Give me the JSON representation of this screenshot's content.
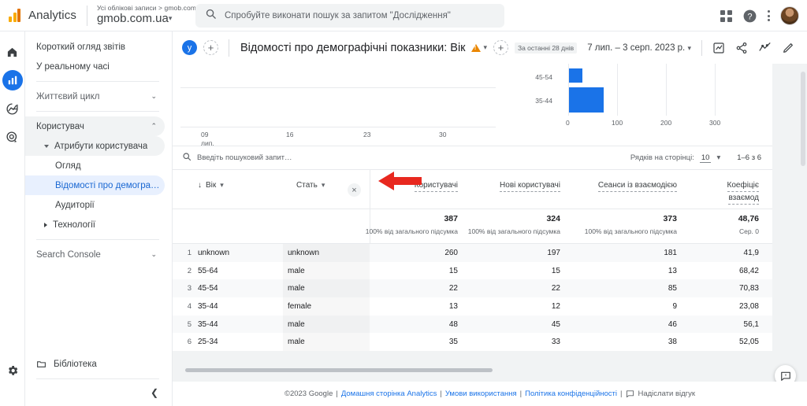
{
  "topbar": {
    "product": "Analytics",
    "account_breadcrumb": "Усі облікові записи > gmob.com.ua",
    "property_name": "gmob.com.ua",
    "property_caret": "▾",
    "search_placeholder": "Спробуйте виконати пошук за запитом \"Дослідження\"",
    "icons": {
      "search": "search-icon",
      "apps": "apps-grid-icon",
      "help": "help-icon",
      "more": "more-vert-icon",
      "avatar": "user-avatar"
    }
  },
  "rail": {
    "items": [
      {
        "name": "home",
        "label": "Головна",
        "active": false
      },
      {
        "name": "reports",
        "label": "Звіти",
        "active": true
      },
      {
        "name": "explore",
        "label": "Дослідження",
        "active": false
      },
      {
        "name": "advertising",
        "label": "Реклама",
        "active": false
      }
    ],
    "settings_label": "Адміністратор"
  },
  "sidebar": {
    "items": [
      {
        "label": "Короткий огляд звітів",
        "indent": 0,
        "state": "normal",
        "toggle": ""
      },
      {
        "label": "У реальному часі",
        "indent": 0,
        "state": "normal",
        "toggle": ""
      },
      {
        "label": "Життєвий цикл",
        "indent": 0,
        "state": "muted",
        "toggle": "chevron-down"
      },
      {
        "label": "Користувач",
        "indent": 0,
        "state": "sel-grey",
        "toggle": "chevron-up"
      },
      {
        "label": "Атрибути користувача",
        "indent": 1,
        "state": "sel-grey",
        "toggle": "tri-down"
      },
      {
        "label": "Огляд",
        "indent": 2,
        "state": "normal",
        "toggle": ""
      },
      {
        "label": "Відомості про демографічн…",
        "indent": 2,
        "state": "sel-blue",
        "toggle": ""
      },
      {
        "label": "Аудиторії",
        "indent": 2,
        "state": "normal",
        "toggle": ""
      },
      {
        "label": "Технології",
        "indent": 1,
        "state": "normal",
        "toggle": "tri-right"
      },
      {
        "label": "Search Console",
        "indent": 0,
        "state": "muted",
        "toggle": "chevron-down"
      }
    ],
    "library_label": "Бібліотека",
    "library_icon": "folder-icon",
    "collapse_icon": "chevron-left-icon"
  },
  "pagehead": {
    "badge_letter": "у",
    "add_badge": "+",
    "title": "Відомості про демографічні показники: Вік",
    "warning_icon": "warning-triangle-icon",
    "warning_caret": "▾",
    "add_comparison": "+",
    "date_chip": "За останні 28 днів",
    "date_range": "7 лип. – 3 серп. 2023 р.",
    "date_caret": "▾",
    "actions": [
      {
        "name": "insights-icon",
        "label": "Статистика"
      },
      {
        "name": "share-icon",
        "label": "Поділитися"
      },
      {
        "name": "compare-icon",
        "label": "Порівняти"
      },
      {
        "name": "edit-pencil-icon",
        "label": "Редагувати"
      }
    ]
  },
  "chart_data": [
    {
      "type": "line",
      "title": "",
      "xlabel": "",
      "ylabel": "",
      "x_ticks": [
        "09\nлип.",
        "16",
        "23",
        "30"
      ],
      "grid": true,
      "series": [
        {
          "name": "Користувачі",
          "values": []
        }
      ]
    },
    {
      "type": "bar",
      "orientation": "horizontal",
      "title": "",
      "categories": [
        "45-54",
        "35-44"
      ],
      "values": [
        22,
        61
      ],
      "xlim": [
        0,
        340
      ],
      "x_ticks": [
        0,
        100,
        200,
        300
      ],
      "xlabel": "",
      "ylabel": "",
      "color": "#1a73e8",
      "grid": true,
      "note": "Верхня частина діаграми обрізана"
    }
  ],
  "table": {
    "search_placeholder": "Введіть пошуковий запит…",
    "search_icon": "search-icon",
    "rows_per_page_label": "Рядків на сторінці:",
    "rows_per_page_value": "10",
    "rows_per_page_caret": "▾",
    "pagination": "1–6 з 6",
    "dim_headers": [
      {
        "label": "Вік",
        "sort_icon": "arrow-down-icon",
        "caret": "▾"
      },
      {
        "label": "Стать",
        "sort_icon": "",
        "caret": "▾"
      }
    ],
    "remove_dim_icon": "×",
    "metric_headers": [
      "Користувачі",
      "Нові користувачі",
      "Сеанси із взаємодією",
      "Коефіціє"
    ],
    "metric_header_line2": [
      "",
      "",
      "",
      "взаємод"
    ],
    "totals": [
      "387",
      "324",
      "373",
      "48,76"
    ],
    "totals_sub": [
      "100% від загального підсумка",
      "100% від загального підсумка",
      "100% від загального підсумка",
      "Сер. 0"
    ],
    "rows": [
      {
        "idx": "1",
        "age": "unknown",
        "gender": "unknown",
        "users": "260",
        "new_users": "197",
        "sessions": "181",
        "rate": "41,9"
      },
      {
        "idx": "2",
        "age": "55-64",
        "gender": "male",
        "users": "15",
        "new_users": "15",
        "sessions": "13",
        "rate": "68,42"
      },
      {
        "idx": "3",
        "age": "45-54",
        "gender": "male",
        "users": "22",
        "new_users": "22",
        "sessions": "85",
        "rate": "70,83"
      },
      {
        "idx": "4",
        "age": "35-44",
        "gender": "female",
        "users": "13",
        "new_users": "12",
        "sessions": "9",
        "rate": "23,08"
      },
      {
        "idx": "5",
        "age": "35-44",
        "gender": "male",
        "users": "48",
        "new_users": "45",
        "sessions": "46",
        "rate": "56,1"
      },
      {
        "idx": "6",
        "age": "25-34",
        "gender": "male",
        "users": "35",
        "new_users": "33",
        "sessions": "38",
        "rate": "52,05"
      }
    ]
  },
  "annotation": {
    "type": "red-arrow",
    "points_to": "remove-dimension-button",
    "color": "#e8281f"
  },
  "footer": {
    "copyright": "©2023 Google",
    "sep": "|",
    "links": [
      "Домашня сторінка Analytics",
      "Умови використання",
      "Політика конфіденційності"
    ],
    "feedback_icon": "feedback-icon",
    "feedback_label": "Надіслати відгук"
  },
  "float_feedback": {
    "icon": "feedback-bubble-icon",
    "label": "Відгук"
  }
}
